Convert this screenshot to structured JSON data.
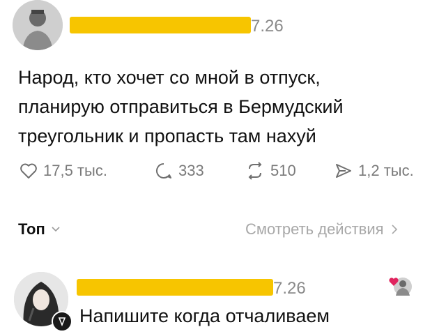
{
  "post": {
    "date_fragment": "7.26",
    "text_line1": "Народ, кто хочет со мной в отпуск,",
    "text_line2": "планирую отправиться в Бермудский",
    "text_line3": "треугольник и пропасть там нахуй",
    "likes": "17,5 тыс.",
    "replies": "333",
    "reposts": "510",
    "shares": "1,2 тыс."
  },
  "sort": {
    "label": "Топ",
    "actions_link": "Смотреть действия"
  },
  "reply": {
    "date_fragment": "7.26",
    "text": "Напишите когда отчаливаем"
  },
  "colors": {
    "redaction": "#f7c500",
    "heart_badge": "#e0245e"
  }
}
